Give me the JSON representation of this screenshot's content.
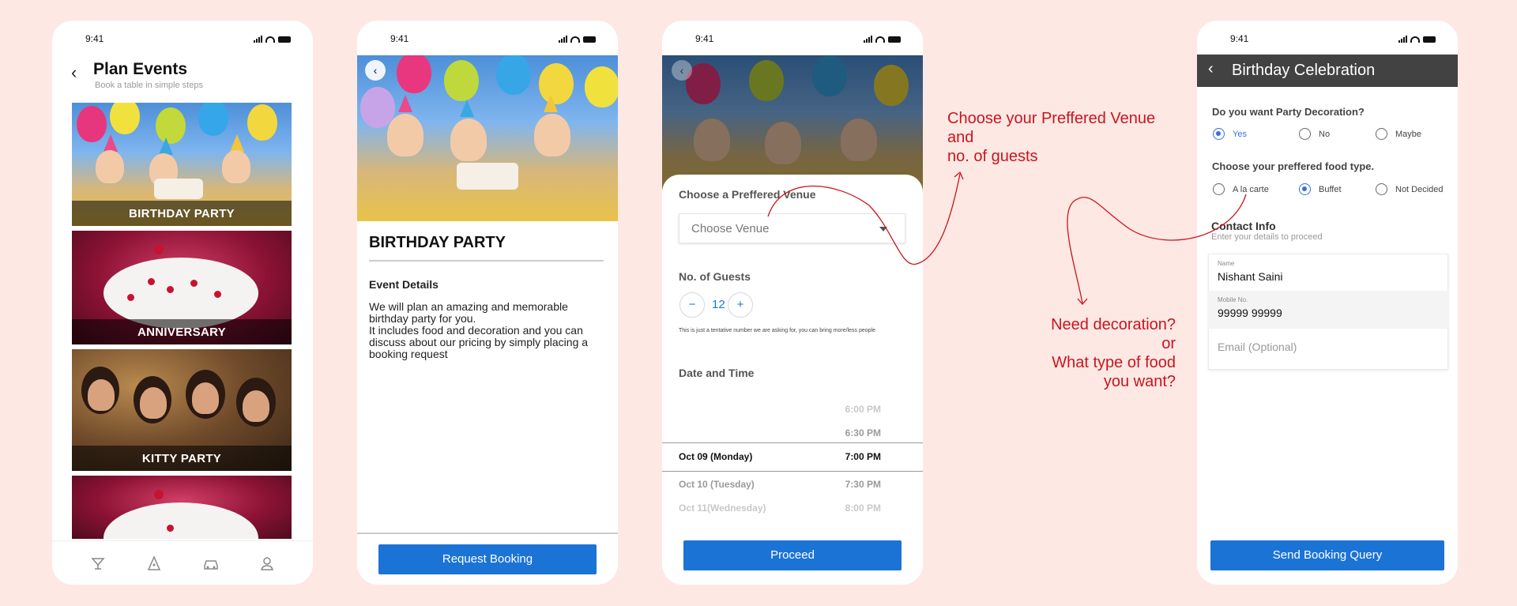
{
  "status_time": "9:41",
  "screen1": {
    "title": "Plan Events",
    "subtitle": "Book a table in simple steps",
    "cards": [
      {
        "label": "BIRTHDAY PARTY"
      },
      {
        "label": "ANNIVERSARY"
      },
      {
        "label": "KITTY PARTY"
      }
    ],
    "tabs": [
      "cocktail-icon",
      "party-hat-icon",
      "car-icon",
      "profile-icon"
    ]
  },
  "screen2": {
    "title": "BIRTHDAY PARTY",
    "details_heading": "Event Details",
    "details_body": "We will plan an amazing and memorable birthday party for you.\nIt includes food and decoration and you can discuss about our pricing by simply placing a booking request",
    "button": "Request Booking"
  },
  "screen3": {
    "venue_label": "Choose a Preffered Venue",
    "venue_placeholder": "Choose Venue",
    "guests_label": "No. of Guests",
    "guests_minus": "−",
    "guests_plus": "+",
    "guests_value": "12",
    "guests_note": "This is just a tentative number we are asking for, you can bring more/less people",
    "datetime_label": "Date and Time",
    "picker_rows": [
      {
        "date": "",
        "time": "6:00 PM"
      },
      {
        "date": "",
        "time": "6:30 PM"
      },
      {
        "date": "Oct 09 (Monday)",
        "time": "7:00 PM"
      },
      {
        "date": "Oct 10 (Tuesday)",
        "time": "7:30 PM"
      },
      {
        "date": "Oct 11(Wednesday)",
        "time": "8:00 PM"
      }
    ],
    "button": "Proceed"
  },
  "screen4": {
    "title": "Birthday Celebration",
    "decoration_q": "Do you want  Party Decoration?",
    "decoration_opts": [
      "Yes",
      "No",
      "Maybe"
    ],
    "decoration_selected": "Yes",
    "food_q": "Choose your preffered food type.",
    "food_opts": [
      "A la carte",
      "Buffet",
      "Not Decided"
    ],
    "food_selected": "Buffet",
    "contact_title": "Contact Info",
    "contact_sub": "Enter your details to proceed",
    "name_label": "Name",
    "name_value": "Nishant Saini",
    "mobile_label": "Mobile No.",
    "mobile_value": "99999 99999",
    "email_placeholder": "Email (Optional)",
    "button": "Send Booking Query"
  },
  "annotations": {
    "venue_note_1": "Choose your Preffered Venue",
    "venue_note_2": "and",
    "venue_note_3": "no. of guests",
    "deco_note_1": "Need decoration?",
    "deco_note_2": "or",
    "deco_note_3": "What type of food",
    "deco_note_4": "you want?"
  },
  "colors": {
    "background": "#fde8e4",
    "primary": "#1b73d6",
    "annotation": "#c8161d",
    "appbar": "#424242"
  }
}
